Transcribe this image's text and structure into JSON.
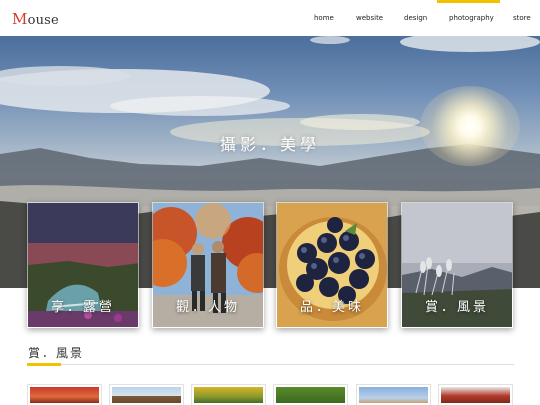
{
  "site": {
    "logo_initial": "M",
    "logo_rest": "ouse"
  },
  "nav": {
    "items": [
      {
        "label": "home",
        "active": false
      },
      {
        "label": "website",
        "active": false
      },
      {
        "label": "design",
        "active": false
      },
      {
        "label": "photography",
        "active": true
      },
      {
        "label": "store",
        "active": false
      }
    ]
  },
  "hero": {
    "title": "攝影．美學"
  },
  "cards": [
    {
      "label": "享．露營",
      "image": "camping-tent-night-scene"
    },
    {
      "label": "觀．人物",
      "image": "couple-autumn-trees"
    },
    {
      "label": "品．美味",
      "image": "blueberry-tart"
    },
    {
      "label": "賞．風景",
      "image": "mountain-reeds-landscape"
    }
  ],
  "section": {
    "title": "賞．風景"
  },
  "thumbnails": [
    {
      "image": "red-foliage"
    },
    {
      "image": "pagoda-sky"
    },
    {
      "image": "yellow-flowers"
    },
    {
      "image": "green-foliage"
    },
    {
      "image": "blue-sky-building"
    },
    {
      "image": "red-temple-roof"
    }
  ],
  "colors": {
    "accent": "#f2c200",
    "logo_red": "#d23a2a"
  }
}
